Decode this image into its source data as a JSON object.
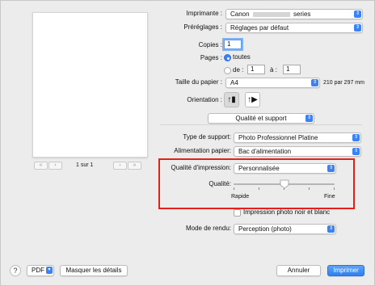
{
  "printer": {
    "label": "Imprimante :",
    "value_prefix": "Canon",
    "value_suffix": "series"
  },
  "presets": {
    "label": "Préréglages :",
    "value": "Réglages par défaut"
  },
  "copies": {
    "label": "Copies :",
    "value": "1"
  },
  "pages": {
    "label": "Pages :",
    "all_label": "toutes",
    "from_label": "de :",
    "from_value": "1",
    "to_label": "à :",
    "to_value": "1"
  },
  "paper_size": {
    "label": "Taille du papier :",
    "value": "A4",
    "dimensions": "210 par 297 mm"
  },
  "orientation": {
    "label": "Orientation :"
  },
  "panel_menu": {
    "value": "Qualité et support"
  },
  "media_type": {
    "label": "Type de support:",
    "value": "Photo Professionnel Platine"
  },
  "paper_source": {
    "label": "Alimentation papier:",
    "value": "Bac d'alimentation"
  },
  "print_quality": {
    "label": "Qualité d'impression:",
    "value": "Personnalisée"
  },
  "quality_slider": {
    "label": "Qualité:",
    "min_label": "Rapide",
    "max_label": "Fine",
    "level": 0.5
  },
  "bw_photo": {
    "label": "Impression photo noir et blanc",
    "checked": false
  },
  "render_mode": {
    "label": "Mode de rendu:",
    "value": "Perception (photo)"
  },
  "preview": {
    "page_indicator": "1 sur 1"
  },
  "footer": {
    "help": "?",
    "pdf": "PDF",
    "hide_details": "Masquer les détails",
    "cancel": "Annuler",
    "print": "Imprimer"
  },
  "colors": {
    "accent": "#3b82f6",
    "highlight_box": "#e3211c"
  }
}
